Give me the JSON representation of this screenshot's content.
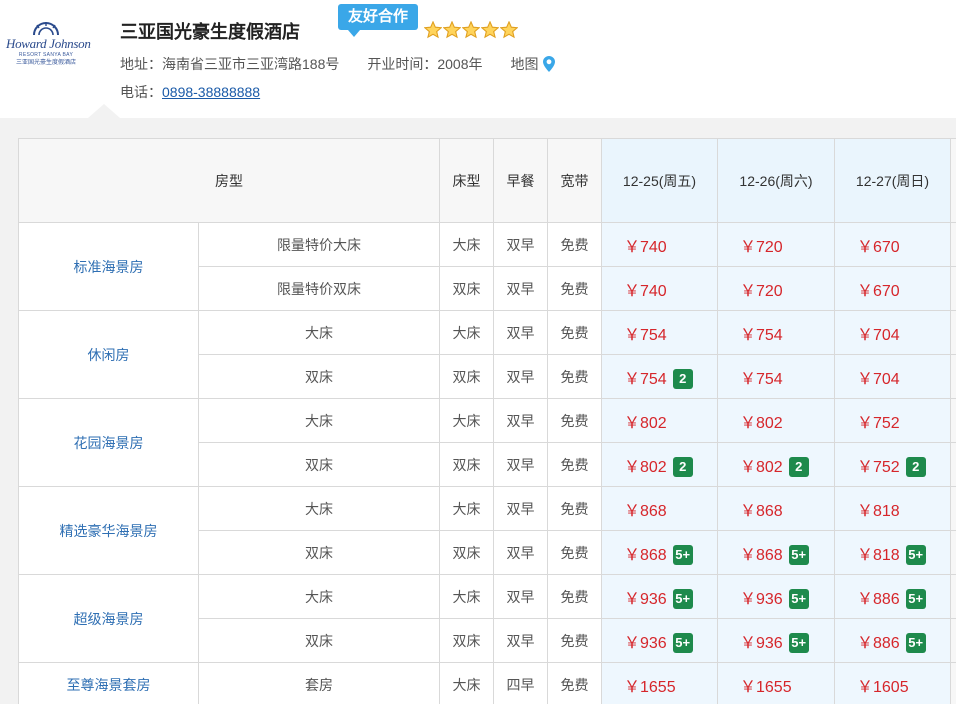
{
  "hotel": {
    "name": "三亚国光豪生度假酒店",
    "partner_badge": "友好合作",
    "star_count": 5,
    "address_label": "地址：",
    "address": "海南省三亚市三亚湾路188号",
    "opening_label": "开业时间：",
    "opening_year": "2008年",
    "map_label": "地图",
    "phone_label": "电话：",
    "phone": "0898-38888888",
    "logo": {
      "name": "Howard Johnson",
      "sub": "RESORT SANYA BAY",
      "cn": "三亚国光豪生度假酒店"
    }
  },
  "colors": {
    "badge_blue": "#3aa7e8",
    "price_red": "#d6262b",
    "room_link_blue": "#2f6fb3",
    "availability_green": "#1e8a4c",
    "date_column_bg": "#eef7fe"
  },
  "table": {
    "headers": {
      "room_type": "房型",
      "bed": "床型",
      "breakfast": "早餐",
      "broadband": "宽带",
      "dates": [
        "12-25(周五)",
        "12-26(周六)",
        "12-27(周日)"
      ]
    },
    "groups": [
      {
        "name": "标准海景房",
        "rows": [
          {
            "variant": "限量特价大床",
            "bed": "大床",
            "breakfast": "双早",
            "broadband": "免费",
            "prices": [
              {
                "price": "￥740",
                "badge": ""
              },
              {
                "price": "￥720",
                "badge": ""
              },
              {
                "price": "￥670",
                "badge": ""
              }
            ]
          },
          {
            "variant": "限量特价双床",
            "bed": "双床",
            "breakfast": "双早",
            "broadband": "免费",
            "prices": [
              {
                "price": "￥740",
                "badge": ""
              },
              {
                "price": "￥720",
                "badge": ""
              },
              {
                "price": "￥670",
                "badge": ""
              }
            ]
          }
        ]
      },
      {
        "name": "休闲房",
        "rows": [
          {
            "variant": "大床",
            "bed": "大床",
            "breakfast": "双早",
            "broadband": "免费",
            "prices": [
              {
                "price": "￥754",
                "badge": ""
              },
              {
                "price": "￥754",
                "badge": ""
              },
              {
                "price": "￥704",
                "badge": ""
              }
            ]
          },
          {
            "variant": "双床",
            "bed": "双床",
            "breakfast": "双早",
            "broadband": "免费",
            "prices": [
              {
                "price": "￥754",
                "badge": "2"
              },
              {
                "price": "￥754",
                "badge": ""
              },
              {
                "price": "￥704",
                "badge": ""
              }
            ]
          }
        ]
      },
      {
        "name": "花园海景房",
        "rows": [
          {
            "variant": "大床",
            "bed": "大床",
            "breakfast": "双早",
            "broadband": "免费",
            "prices": [
              {
                "price": "￥802",
                "badge": ""
              },
              {
                "price": "￥802",
                "badge": ""
              },
              {
                "price": "￥752",
                "badge": ""
              }
            ]
          },
          {
            "variant": "双床",
            "bed": "双床",
            "breakfast": "双早",
            "broadband": "免费",
            "prices": [
              {
                "price": "￥802",
                "badge": "2"
              },
              {
                "price": "￥802",
                "badge": "2"
              },
              {
                "price": "￥752",
                "badge": "2"
              }
            ]
          }
        ]
      },
      {
        "name": "精选豪华海景房",
        "rows": [
          {
            "variant": "大床",
            "bed": "大床",
            "breakfast": "双早",
            "broadband": "免费",
            "prices": [
              {
                "price": "￥868",
                "badge": ""
              },
              {
                "price": "￥868",
                "badge": ""
              },
              {
                "price": "￥818",
                "badge": ""
              }
            ]
          },
          {
            "variant": "双床",
            "bed": "双床",
            "breakfast": "双早",
            "broadband": "免费",
            "prices": [
              {
                "price": "￥868",
                "badge": "5+"
              },
              {
                "price": "￥868",
                "badge": "5+"
              },
              {
                "price": "￥818",
                "badge": "5+"
              }
            ]
          }
        ]
      },
      {
        "name": "超级海景房",
        "rows": [
          {
            "variant": "大床",
            "bed": "大床",
            "breakfast": "双早",
            "broadband": "免费",
            "prices": [
              {
                "price": "￥936",
                "badge": "5+"
              },
              {
                "price": "￥936",
                "badge": "5+"
              },
              {
                "price": "￥886",
                "badge": "5+"
              }
            ]
          },
          {
            "variant": "双床",
            "bed": "双床",
            "breakfast": "双早",
            "broadband": "免费",
            "prices": [
              {
                "price": "￥936",
                "badge": "5+"
              },
              {
                "price": "￥936",
                "badge": "5+"
              },
              {
                "price": "￥886",
                "badge": "5+"
              }
            ]
          }
        ]
      },
      {
        "name": "至尊海景套房",
        "rows": [
          {
            "variant": "套房",
            "bed": "大床",
            "breakfast": "四早",
            "broadband": "免费",
            "prices": [
              {
                "price": "￥1655",
                "badge": ""
              },
              {
                "price": "￥1655",
                "badge": ""
              },
              {
                "price": "￥1605",
                "badge": ""
              }
            ]
          }
        ]
      }
    ]
  }
}
